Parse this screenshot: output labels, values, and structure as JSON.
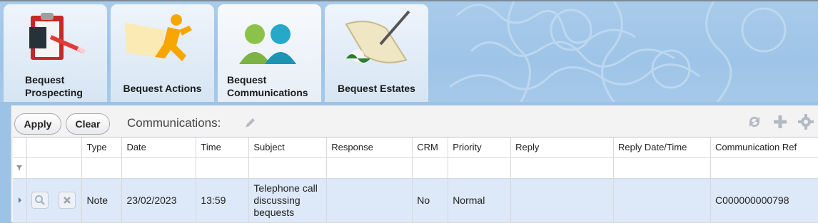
{
  "tabs": [
    {
      "line1": "Bequest",
      "line2": "Prospecting",
      "icon": "clipboard-icon"
    },
    {
      "label": "Bequest Actions",
      "icon": "running-man-icon"
    },
    {
      "line1": "Bequest",
      "line2": "Communications",
      "icon": "people-icon"
    },
    {
      "label": "Bequest Estates",
      "icon": "scroll-quill-icon"
    }
  ],
  "toolbar": {
    "apply_label": "Apply",
    "clear_label": "Clear",
    "title": "Communications:",
    "icons": [
      "pencil-icon",
      "refresh-icon",
      "plus-icon",
      "gear-icon"
    ]
  },
  "grid": {
    "columns": [
      "Type",
      "Date",
      "Time",
      "Subject",
      "Response",
      "CRM",
      "Priority",
      "Reply",
      "Reply Date/Time",
      "Communication Ref"
    ],
    "rows": [
      {
        "type": "Note",
        "date": "23/02/2023",
        "time": "13:59",
        "subject_lines": [
          "Telephone call",
          "discussing",
          "bequests"
        ],
        "response": "",
        "crm": "No",
        "priority": "Normal",
        "reply": "",
        "reply_datetime": "",
        "ref": "C000000000798"
      }
    ]
  },
  "colors": {
    "accent": "#9ec4e7",
    "row_selected": "#dde8f8",
    "icon_grey": "#aab2bb"
  }
}
